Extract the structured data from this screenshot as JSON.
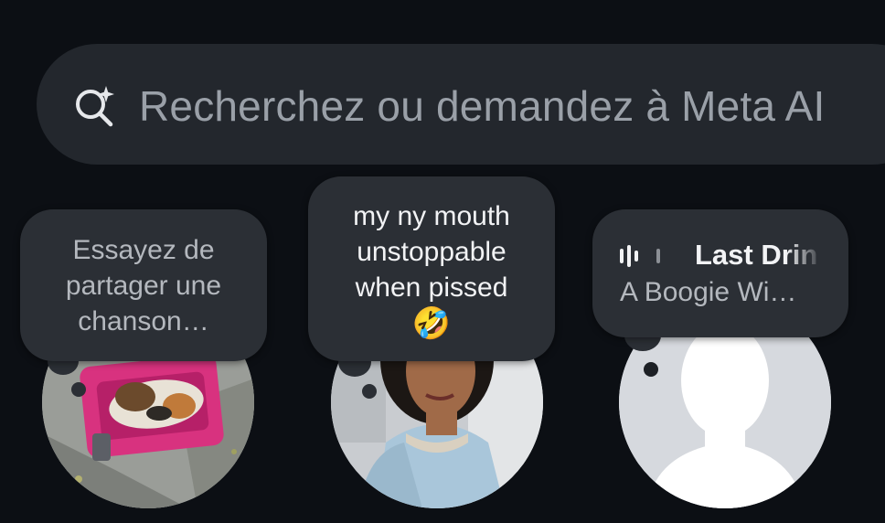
{
  "search": {
    "placeholder": "Recherchez ou demandez à Meta AI",
    "icon": "meta-ai-search-icon"
  },
  "notes": [
    {
      "type": "placeholder",
      "text": "Essayez de\npartager une\nchanson…"
    },
    {
      "type": "text",
      "text": "my ny mouth\nunstoppable\nwhen pissed",
      "emoji": "🤣"
    },
    {
      "type": "music",
      "icon": "music-bars-icon",
      "title": "Last Drin",
      "artist": "A Boogie Wi…"
    }
  ],
  "colors": {
    "background": "#0c0f14",
    "search_bar": "#23272d",
    "bubble": "#2b2f35",
    "placeholder_text": "#9aa0a8"
  }
}
